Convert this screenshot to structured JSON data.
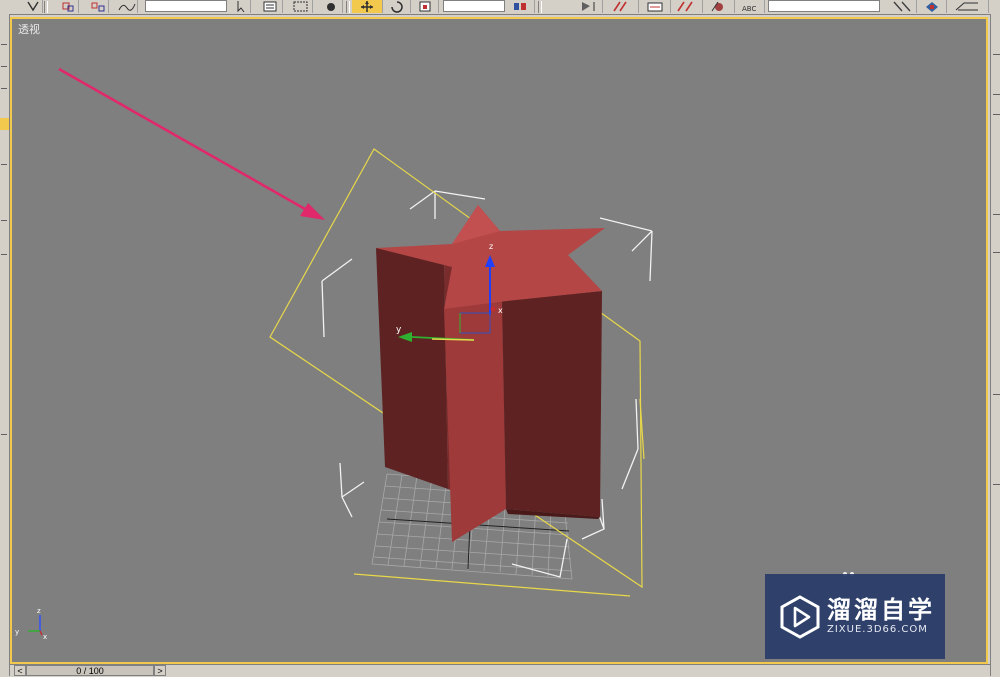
{
  "viewport": {
    "label": "透视",
    "border_color": "#f2c94c",
    "background_color": "#7f7f7f"
  },
  "scene": {
    "object": "star-extrusion",
    "object_color": "#b44646",
    "gizmo_axis_labels": {
      "x": "x",
      "y": "y",
      "z": "z"
    },
    "corner_axis_labels": {
      "x": "x",
      "y": "y",
      "z": "z"
    }
  },
  "annotation": {
    "color": "#e0286a",
    "kind": "arrow"
  },
  "time_slider": {
    "position_text": "0 / 100",
    "prev_icon": "chevron-left-icon",
    "next_icon": "chevron-right-icon"
  },
  "watermark": {
    "brand": "溜溜自学",
    "url": "ZIXUE.3D66.COM",
    "logo_icon": "play-logo-icon",
    "background_color": "#283c69"
  },
  "toolbar": {
    "icons": [
      "select-filter-icon",
      "link-icon",
      "unlink-icon",
      "bind-space-warp-icon",
      "selection-filter-dropdown",
      "select-icon",
      "select-by-name-icon",
      "rectangle-region-icon",
      "window-crossing-icon",
      "move-icon",
      "rotate-icon",
      "scale-icon",
      "reference-coord-dropdown",
      "pivot-center-icon",
      "mirror-icon",
      "align-icon",
      "layers-icon",
      "curve-editor-icon",
      "material-editor-icon",
      "render-setup-icon",
      "render-icon",
      "spelling-abc-icon",
      "named-selection-field",
      "quick-render-icon",
      "render-frame-icon"
    ],
    "active_tool": "move-icon"
  }
}
